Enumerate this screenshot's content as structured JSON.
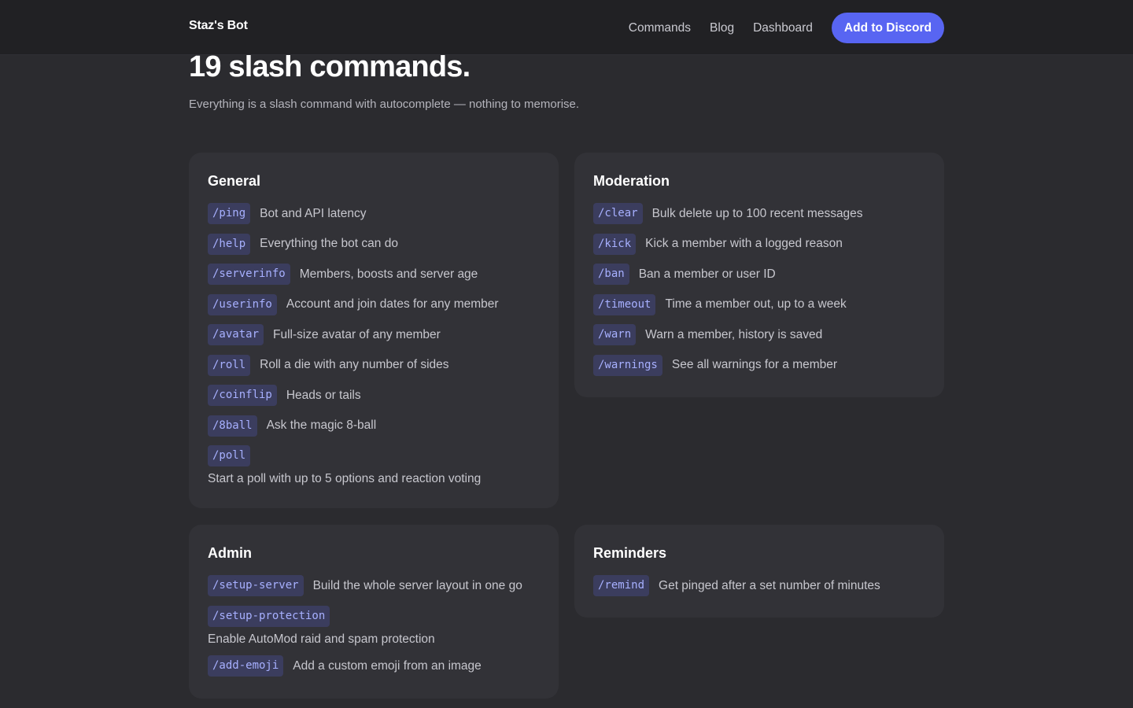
{
  "nav": {
    "brand": "Staz's Bot",
    "links": [
      "Commands",
      "Blog",
      "Dashboard"
    ],
    "cta": "Add to Discord"
  },
  "hero": {
    "title": "19 slash commands.",
    "subtitle": "Everything is a slash command with autocomplete — nothing to memorise."
  },
  "cards": {
    "general": {
      "title": "General",
      "commands": [
        {
          "cmd": "/ping",
          "desc": "Bot and API latency"
        },
        {
          "cmd": "/help",
          "desc": "Everything the bot can do"
        },
        {
          "cmd": "/serverinfo",
          "desc": "Members, boosts and server age"
        },
        {
          "cmd": "/userinfo",
          "desc": "Account and join dates for any member"
        },
        {
          "cmd": "/avatar",
          "desc": "Full-size avatar of any member"
        },
        {
          "cmd": "/roll",
          "desc": "Roll a die with any number of sides"
        },
        {
          "cmd": "/coinflip",
          "desc": "Heads or tails"
        },
        {
          "cmd": "/8ball",
          "desc": "Ask the magic 8-ball"
        },
        {
          "cmd": "/poll",
          "desc": "Start a poll with up to 5 options and reaction voting"
        }
      ]
    },
    "moderation": {
      "title": "Moderation",
      "commands": [
        {
          "cmd": "/clear",
          "desc": "Bulk delete up to 100 recent messages"
        },
        {
          "cmd": "/kick",
          "desc": "Kick a member with a logged reason"
        },
        {
          "cmd": "/ban",
          "desc": "Ban a member or user ID"
        },
        {
          "cmd": "/timeout",
          "desc": "Time a member out, up to a week"
        },
        {
          "cmd": "/warn",
          "desc": "Warn a member, history is saved"
        },
        {
          "cmd": "/warnings",
          "desc": "See all warnings for a member"
        }
      ]
    },
    "admin": {
      "title": "Admin",
      "commands": [
        {
          "cmd": "/setup-server",
          "desc": "Build the whole server layout in one go"
        },
        {
          "cmd": "/setup-protection",
          "desc": "Enable AutoMod raid and spam protection"
        },
        {
          "cmd": "/add-emoji",
          "desc": "Add a custom emoji from an image"
        }
      ]
    },
    "reminders": {
      "title": "Reminders",
      "commands": [
        {
          "cmd": "/remind",
          "desc": "Get pinged after a set number of minutes"
        }
      ]
    }
  }
}
